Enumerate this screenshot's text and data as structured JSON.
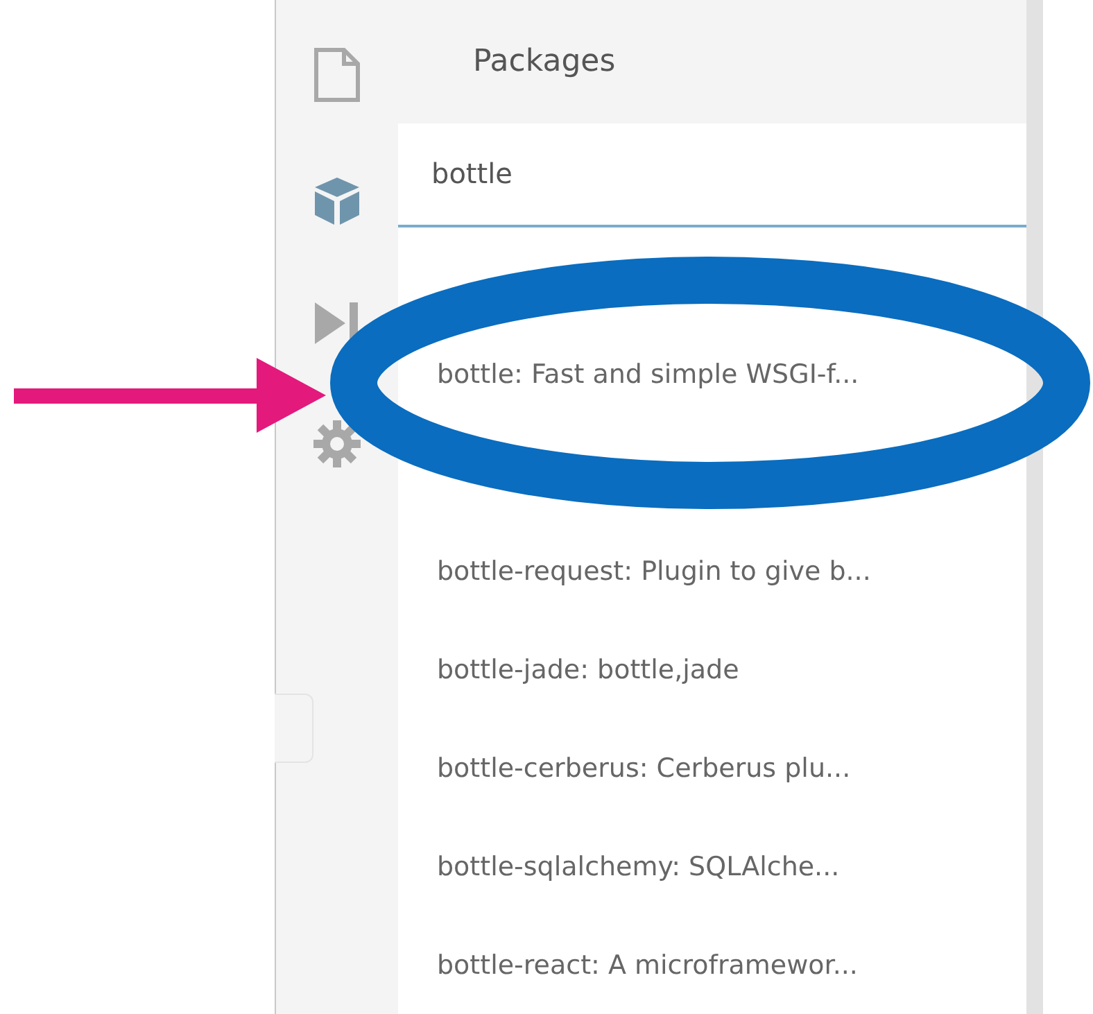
{
  "sidebar": {
    "icons": [
      {
        "kind": "file",
        "selected": false
      },
      {
        "kind": "cube",
        "selected": true
      },
      {
        "kind": "play",
        "selected": false
      },
      {
        "kind": "gear",
        "selected": false
      }
    ]
  },
  "panel": {
    "title": "Packages",
    "search": {
      "value": "bottle"
    },
    "results": [
      {
        "kind": "covered"
      },
      {
        "kind": "text",
        "label": "bottle: Fast and simple WSGI-f..."
      },
      {
        "kind": "covered"
      },
      {
        "kind": "text",
        "label": "bottle-request: Plugin to give b..."
      },
      {
        "kind": "text",
        "label": "bottle-jade: bottle,jade"
      },
      {
        "kind": "text",
        "label": "bottle-cerberus: Cerberus plu..."
      },
      {
        "kind": "text",
        "label": "bottle-sqlalchemy: SQLAlche..."
      },
      {
        "kind": "text",
        "label": "bottle-react: A microframewor..."
      }
    ]
  },
  "annotations": [
    {
      "kind": "arrow",
      "color": "#e3197c"
    },
    {
      "kind": "ellipse",
      "color": "#0a6dbf"
    }
  ]
}
